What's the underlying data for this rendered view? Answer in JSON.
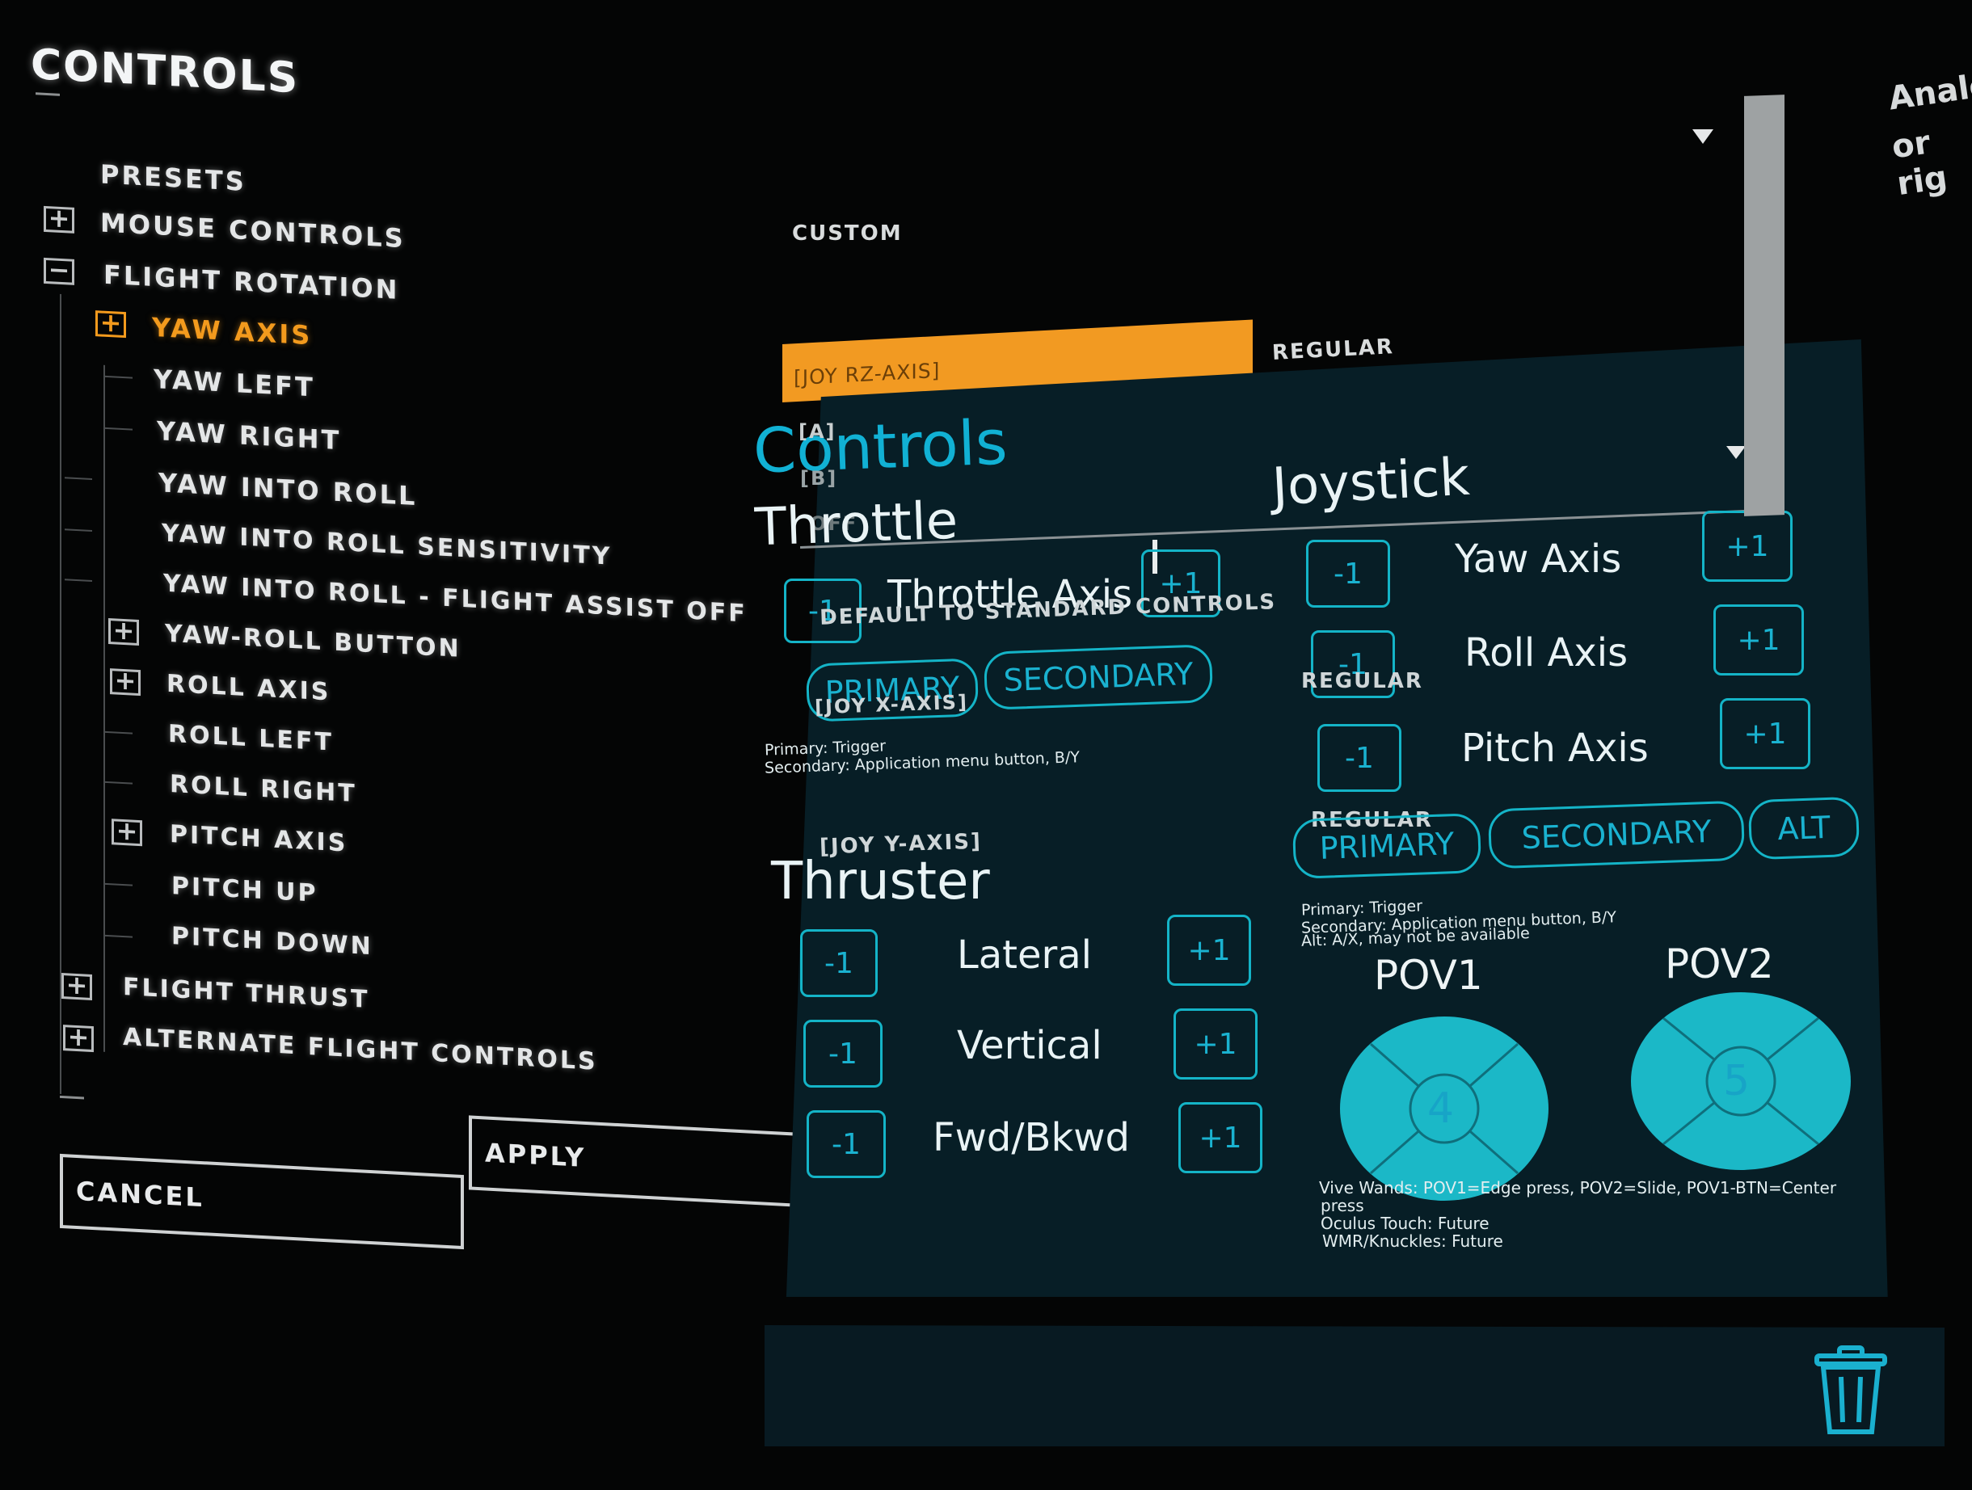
{
  "menu": {
    "title": "CONTROLS",
    "items": [
      {
        "label": "PRESETS"
      },
      {
        "label": "MOUSE CONTROLS",
        "toggle": "+"
      },
      {
        "label": "FLIGHT ROTATION",
        "toggle": "−"
      },
      {
        "label": "YAW AXIS",
        "toggle": "+"
      },
      {
        "label": "YAW LEFT"
      },
      {
        "label": "YAW RIGHT"
      },
      {
        "label": "YAW INTO ROLL"
      },
      {
        "label": "YAW INTO ROLL SENSITIVITY"
      },
      {
        "label": "YAW INTO ROLL - FLIGHT ASSIST OFF"
      },
      {
        "label": "YAW-ROLL BUTTON",
        "toggle": "+"
      },
      {
        "label": "ROLL AXIS",
        "toggle": "+"
      },
      {
        "label": "ROLL LEFT"
      },
      {
        "label": "ROLL RIGHT"
      },
      {
        "label": "PITCH AXIS",
        "toggle": "+"
      },
      {
        "label": "PITCH UP"
      },
      {
        "label": "PITCH DOWN"
      },
      {
        "label": "FLIGHT THRUST",
        "toggle": "+"
      },
      {
        "label": "ALTERNATE FLIGHT CONTROLS",
        "toggle": "+"
      }
    ],
    "cancel_label": "CANCEL",
    "apply_label": "APPLY"
  },
  "settings": {
    "preset_value": "CUSTOM",
    "yaw_binding": "[JOY RZ-AXIS]",
    "yaw_mode": "REGULAR",
    "binding_a": "[A]",
    "binding_b": "[B]",
    "off_label": "OFF",
    "default_label": "DEFAULT TO STANDARD CONTROLS",
    "regular_1": "REGULAR",
    "x_axis_binding": "[JOY X-AXIS]",
    "regular_2": "REGULAR",
    "y_axis_binding": "[JOY Y-AXIS]"
  },
  "panel": {
    "title": "Controls",
    "throttle": {
      "heading": "Throttle",
      "axis_label": "Throttle Axis",
      "minus": "-1",
      "plus": "+1",
      "primary": "PRIMARY",
      "secondary": "SECONDARY",
      "note_1": "Primary: Trigger",
      "note_2": "Secondary: Application menu button, B/Y"
    },
    "joystick": {
      "heading": "Joystick",
      "axes": [
        {
          "label": "Yaw Axis",
          "minus": "-1",
          "plus": "+1"
        },
        {
          "label": "Roll Axis",
          "minus": "-1",
          "plus": "+1"
        },
        {
          "label": "Pitch Axis",
          "minus": "-1",
          "plus": "+1"
        }
      ],
      "primary": "PRIMARY",
      "secondary": "SECONDARY",
      "alt": "ALT",
      "note_1": "Primary: Trigger",
      "note_2": "Secondary: Application menu button, B/Y",
      "note_3": "Alt: A/X, may not be available"
    },
    "thruster": {
      "heading": "Thruster",
      "axes": [
        {
          "label": "Lateral",
          "minus": "-1",
          "plus": "+1"
        },
        {
          "label": "Vertical",
          "minus": "-1",
          "plus": "+1"
        },
        {
          "label": "Fwd/Bkwd",
          "minus": "-1",
          "plus": "+1"
        }
      ]
    },
    "pov": {
      "pov1_label": "POV1",
      "pov1_center": "4",
      "pov2_label": "POV2",
      "pov2_center": "5",
      "note_1": "Vive Wands: POV1=Edge press, POV2=Slide, POV1-BTN=Center",
      "note_2": "press",
      "note_3": "Oculus Touch: Future",
      "note_4": "WMR/Knuckles: Future"
    }
  },
  "right": {
    "line_1": "Analo",
    "line_2": "or rig"
  },
  "colors": {
    "accent_orange": "#f29a22",
    "teal": "#14b4c7",
    "panel_bg": "#071e26",
    "pov_fill": "#1bb8c7"
  },
  "icons": [
    "expand-icon",
    "collapse-icon",
    "dropdown-arrow-icon",
    "trash-icon"
  ]
}
